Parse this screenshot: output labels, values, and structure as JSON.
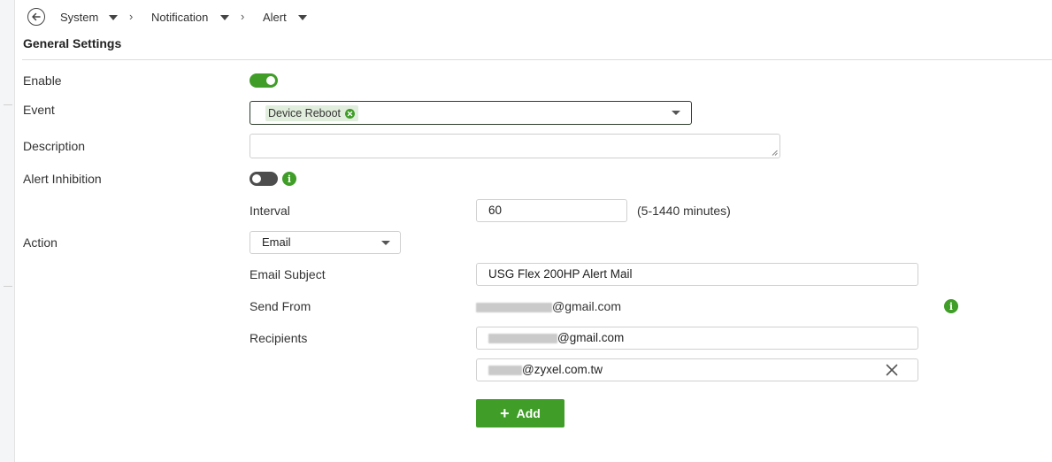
{
  "breadcrumb": {
    "items": [
      "System",
      "Notification",
      "Alert"
    ]
  },
  "section": {
    "title": "General Settings"
  },
  "form": {
    "enable": {
      "label": "Enable",
      "checked": true
    },
    "event": {
      "label": "Event",
      "selected_chip": "Device Reboot"
    },
    "description": {
      "label": "Description",
      "value": ""
    },
    "alert_inhibition": {
      "label": "Alert Inhibition",
      "checked": false
    },
    "interval": {
      "label": "Interval",
      "value": "60",
      "hint": "(5-1440 minutes)"
    },
    "action": {
      "label": "Action",
      "selected": "Email"
    },
    "email_subject": {
      "label": "Email Subject",
      "value": "USG Flex 200HP Alert Mail"
    },
    "send_from": {
      "label": "Send From",
      "value_suffix": "@gmail.com"
    },
    "recipients": {
      "label": "Recipients",
      "items": [
        {
          "value_suffix": "@gmail.com"
        },
        {
          "value_suffix": "@zyxel.com.tw"
        }
      ]
    },
    "add_button": {
      "label": "Add"
    }
  },
  "colors": {
    "accent": "#3f9d28",
    "toggle_off": "#4d4d4d"
  },
  "icons": [
    "back-arrow-icon",
    "chevron-down-icon",
    "chevron-right-icon",
    "close-icon",
    "info-icon",
    "plus-icon"
  ]
}
